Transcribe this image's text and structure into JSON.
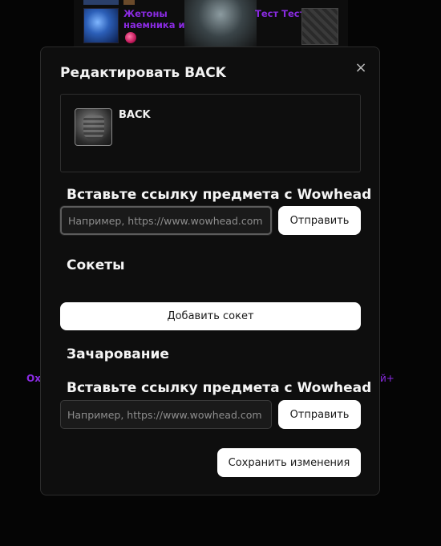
{
  "background": {
    "item_link": "Жетоны наемника из...",
    "character_name": "Тест Тест",
    "side_left": "Ох",
    "side_right": "й+"
  },
  "modal": {
    "title": "Редактировать BACK",
    "close_glyph": "×",
    "item": {
      "name": "BACK",
      "icon": "cloak-icon"
    },
    "link_section": {
      "title": "Вставьте ссылку предмета с Wowhead",
      "placeholder": "Например, https://www.wowhead.com",
      "value": "",
      "submit_label": "Отправить"
    },
    "sockets": {
      "title": "Сокеты",
      "add_label": "Добавить сокет"
    },
    "enchant": {
      "title": "Зачарование",
      "link_title": "Вставьте ссылку предмета с Wowhead",
      "placeholder": "Например, https://www.wowhead.com",
      "value": "",
      "submit_label": "Отправить"
    },
    "save_label": "Сохранить изменения"
  },
  "colors": {
    "accent_purple": "#8a2be2",
    "modal_bg": "#0e0e0e",
    "button_bg": "#ffffff"
  }
}
